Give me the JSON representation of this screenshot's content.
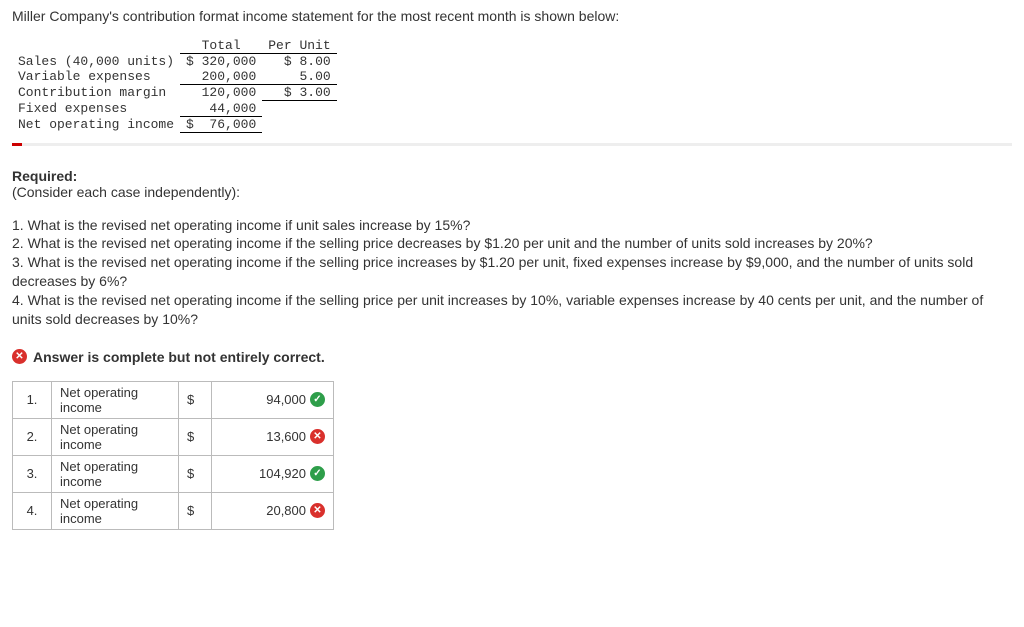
{
  "intro": "Miller Company's contribution format income statement for the most recent month is shown below:",
  "income_statement": {
    "headers": {
      "total": "Total",
      "per_unit": "Per Unit"
    },
    "rows": [
      {
        "label": "Sales (40,000 units)",
        "total": "$ 320,000",
        "per_unit": "$ 8.00",
        "total_underline": false,
        "pu_underline": false
      },
      {
        "label": "Variable expenses",
        "total": "  200,000",
        "per_unit": "  5.00",
        "total_underline": true,
        "pu_underline": true
      },
      {
        "label": "Contribution margin",
        "total": "  120,000",
        "per_unit": "$ 3.00",
        "total_underline": false,
        "pu_underline": true
      },
      {
        "label": "Fixed expenses",
        "total": "   44,000",
        "per_unit": "",
        "total_underline": true,
        "pu_underline": false
      },
      {
        "label": "Net operating income",
        "total": "$  76,000",
        "per_unit": "",
        "total_underline": true,
        "pu_underline": false
      }
    ]
  },
  "required": {
    "title": "Required:",
    "subtitle": "(Consider each case independently):"
  },
  "questions": [
    "1. What is the revised net operating income if unit sales increase by 15%?",
    "2. What is the revised net operating income if the selling price decreases by $1.20 per unit and the number of units sold increases by 20%?",
    "3. What is the revised net operating income if the selling price increases by $1.20 per unit, fixed expenses increase by $9,000, and the number of units sold decreases by 6%?",
    "4. What is the revised net operating income if the selling price per unit increases by 10%, variable expenses increase by 40 cents per unit, and the number of units sold decreases by 10%?"
  ],
  "feedback": "Answer is complete but not entirely correct.",
  "answers": [
    {
      "n": "1.",
      "label": "Net operating income",
      "currency": "$",
      "value": "94,000",
      "correct": true
    },
    {
      "n": "2.",
      "label": "Net operating income",
      "currency": "$",
      "value": "13,600",
      "correct": false
    },
    {
      "n": "3.",
      "label": "Net operating income",
      "currency": "$",
      "value": "104,920",
      "correct": true
    },
    {
      "n": "4.",
      "label": "Net operating income",
      "currency": "$",
      "value": "20,800",
      "correct": false
    }
  ],
  "icons": {
    "check": "✓",
    "cross": "✕"
  }
}
